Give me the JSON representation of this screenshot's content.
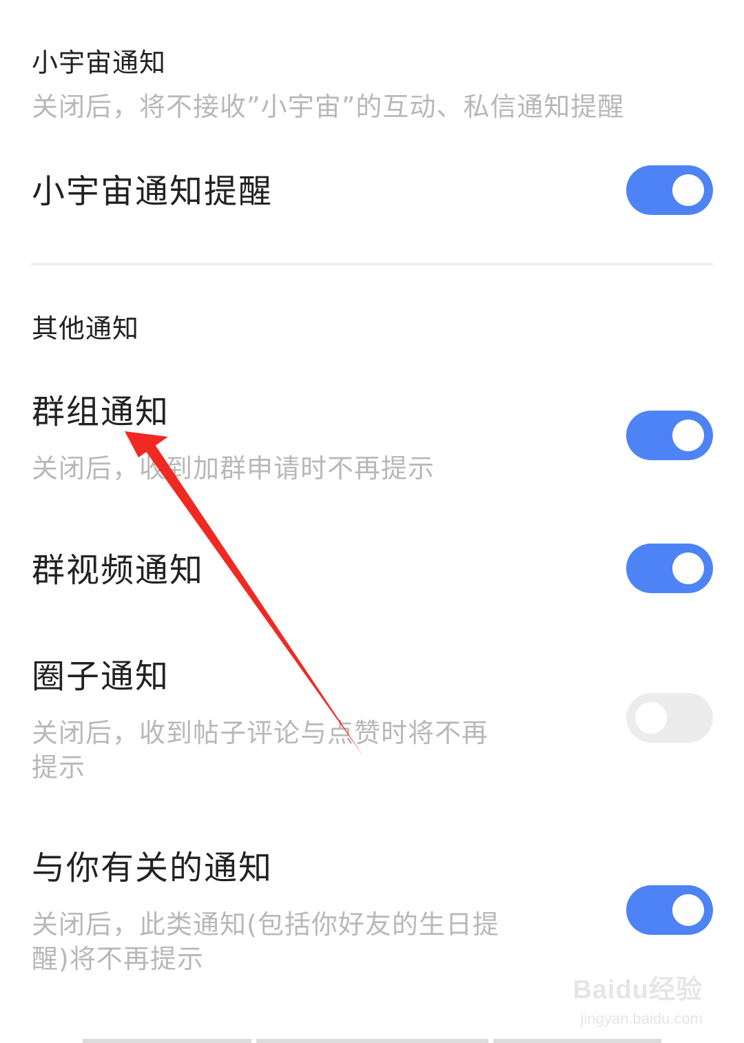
{
  "universe_section": {
    "title": "小宇宙通知",
    "desc": "关闭后，将不接收”小宇宙”的互动、私信通知提醒",
    "row_label": "小宇宙通知提醒",
    "enabled": true
  },
  "other_section": {
    "title": "其他通知",
    "items": [
      {
        "label": "群组通知",
        "desc": "关闭后，收到加群申请时不再提示",
        "enabled": true
      },
      {
        "label": "群视频通知",
        "desc": "",
        "enabled": true
      },
      {
        "label": "圈子通知",
        "desc_line1": "关闭后，收到帖子评论与点赞时将不再",
        "desc_line2": "提示",
        "enabled": false
      },
      {
        "label": "与你有关的通知",
        "desc_line1": "关闭后，此类通知(包括你好友的生日提",
        "desc_line2": "醒)将不再提示",
        "enabled": true
      }
    ]
  },
  "watermark": {
    "main": "Baidu经验",
    "sub": "jingyan.baidu.com"
  },
  "colors": {
    "toggle_on": "#4e83f5",
    "toggle_off": "#ececec",
    "annotation_arrow": "#f02a23"
  }
}
